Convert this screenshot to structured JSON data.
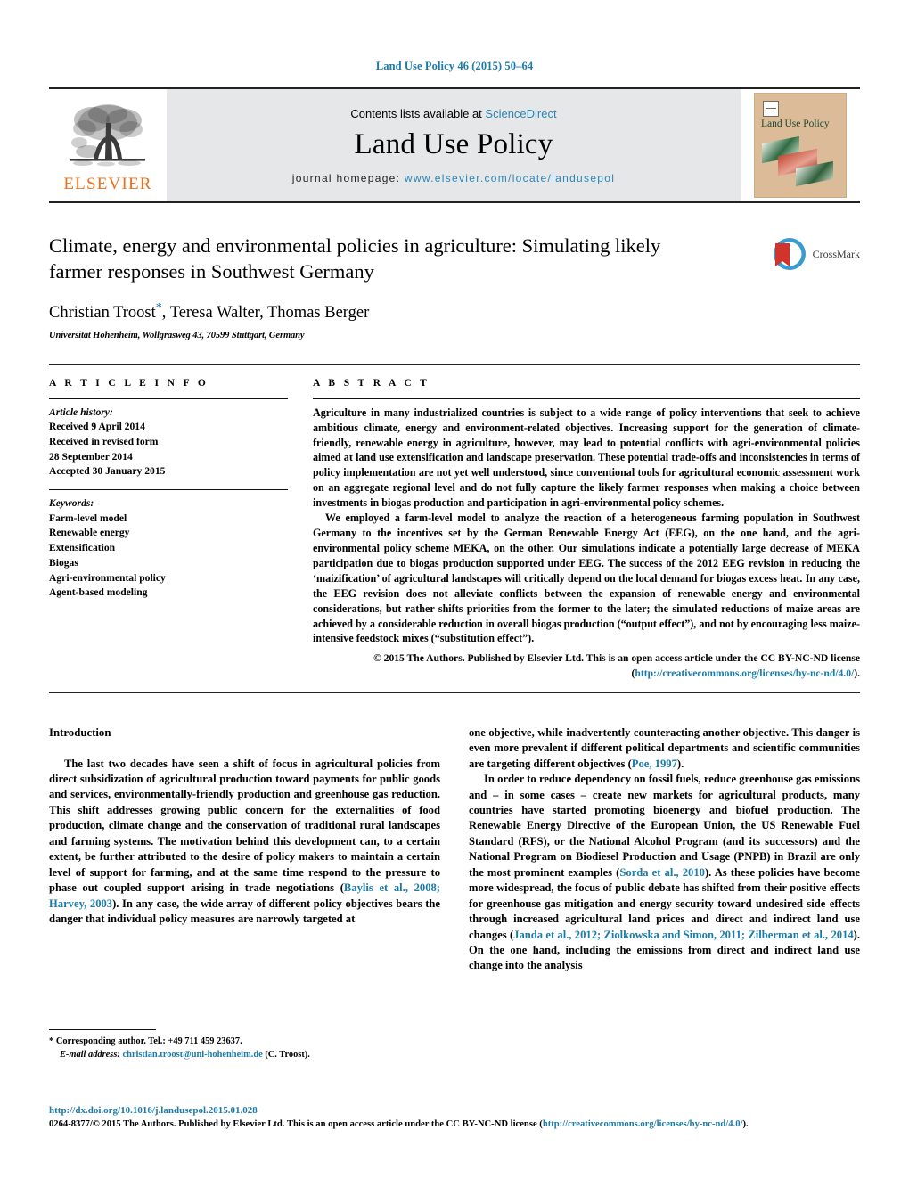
{
  "journal_ref": "Land Use Policy 46 (2015) 50–64",
  "masthead": {
    "publisher_name": "ELSEVIER",
    "contents_prefix": "Contents lists available at ",
    "contents_link": "ScienceDirect",
    "journal_name": "Land Use Policy",
    "homepage_prefix": "journal homepage: ",
    "homepage_url": "www.elsevier.com/locate/landusepol",
    "cover_title": "Land Use Policy"
  },
  "article": {
    "title": "Climate, energy and environmental policies in agriculture: Simulating likely farmer responses in Southwest Germany",
    "authors": "Christian Troost",
    "authors_rest": ", Teresa Walter, Thomas Berger",
    "corresponding_marker": "*",
    "affiliation": "Universität Hohenheim, Wollgrasweg 43, 70599 Stuttgart, Germany",
    "crossmark_label": "CrossMark"
  },
  "article_info": {
    "heading": "A R T I C L E   I N F O",
    "history_label": "Article history:",
    "history": [
      "Received 9 April 2014",
      "Received in revised form",
      "28 September 2014",
      "Accepted 30 January 2015"
    ],
    "keywords_label": "Keywords:",
    "keywords": [
      "Farm-level model",
      "Renewable energy",
      "Extensification",
      "Biogas",
      "Agri-environmental policy",
      "Agent-based modeling"
    ]
  },
  "abstract": {
    "heading": "A B S T R A C T",
    "paragraph1": "Agriculture in many industrialized countries is subject to a wide range of policy interventions that seek to achieve ambitious climate, energy and environment-related objectives. Increasing support for the generation of climate-friendly, renewable energy in agriculture, however, may lead to potential conflicts with agri-environmental policies aimed at land use extensification and landscape preservation. These potential trade-offs and inconsistencies in terms of policy implementation are not yet well understood, since conventional tools for agricultural economic assessment work on an aggregate regional level and do not fully capture the likely farmer responses when making a choice between investments in biogas production and participation in agri-environmental policy schemes.",
    "paragraph2": "We employed a farm-level model to analyze the reaction of a heterogeneous farming population in Southwest Germany to the incentives set by the German Renewable Energy Act (EEG), on the one hand, and the agri-environmental policy scheme MEKA, on the other. Our simulations indicate a potentially large decrease of MEKA participation due to biogas production supported under EEG. The success of the 2012 EEG revision in reducing the ‘maizification’ of agricultural landscapes will critically depend on the local demand for biogas excess heat. In any case, the EEG revision does not alleviate conflicts between the expansion of renewable energy and environmental considerations, but rather shifts priorities from the former to the later; the simulated reductions of maize areas are achieved by a considerable reduction in overall biogas production (“output effect”), and not by encouraging less maize-intensive feedstock mixes (“substitution effect”).",
    "copyright_text_1": "© 2015 The Authors. Published by Elsevier Ltd. This is an open access article under the CC BY-NC-ND license (",
    "copyright_link": "http://creativecommons.org/licenses/by-nc-nd/4.0/",
    "copyright_text_2": ")."
  },
  "introduction": {
    "heading": "Introduction",
    "left_p1_a": "The last two decades have seen a shift of focus in agricultural policies from direct subsidization of agricultural production toward payments for public goods and services, environmentally-friendly production and greenhouse gas reduction. This shift addresses growing public concern for the externalities of food production, climate change and the conservation of traditional rural landscapes and farming systems. The motivation behind this development can, to a certain extent, be further attributed to the desire of policy makers to maintain a certain level of support for farming, and at the same time respond to the pressure to phase out coupled support arising in trade negotiations (",
    "left_cite1": "Baylis et al., 2008; Harvey, 2003",
    "left_p1_b": "). In any case, the wide array of different policy objectives bears the danger that individual policy measures are narrowly targeted at",
    "right_p1_a": "one objective, while inadvertently counteracting another objective. This danger is even more prevalent if different political departments and scientific communities are targeting different objectives (",
    "right_cite1": "Poe, 1997",
    "right_p1_b": ").",
    "right_p2_a": "In order to reduce dependency on fossil fuels, reduce greenhouse gas emissions and – in some cases – create new markets for agricultural products, many countries have started promoting bioenergy and biofuel production. The Renewable Energy Directive of the European Union, the US Renewable Fuel Standard (RFS), or the National Alcohol Program (and its successors) and the National Program on Biodiesel Production and Usage (PNPB) in Brazil are only the most prominent examples (",
    "right_cite2": "Sorda et al., 2010",
    "right_p2_b": "). As these policies have become more widespread, the focus of public debate has shifted from their positive effects for greenhouse gas mitigation and energy security toward undesired side effects through increased agricultural land prices and direct and indirect land use changes (",
    "right_cite3": "Janda et al., 2012; Ziolkowska and Simon, 2011; Zilberman et al., 2014",
    "right_p2_c": "). On the one hand, including the emissions from direct and indirect land use change into the analysis"
  },
  "footnote": {
    "star": "*",
    "corresponding": "Corresponding author. Tel.: +49 711 459 23637.",
    "email_label": "E-mail address:",
    "email": "christian.troost@uni-hohenheim.de",
    "email_suffix": "(C. Troost)."
  },
  "page_footer": {
    "doi": "http://dx.doi.org/10.1016/j.landusepol.2015.01.028",
    "issn_text_1": "0264-8377/© 2015 The Authors. Published by Elsevier Ltd. This is an open access article under the CC BY-NC-ND license (",
    "issn_link": "http://creativecommons.org/licenses/by-nc-nd/4.0/",
    "issn_text_2": ")."
  },
  "colors": {
    "link": "#1a7aa8",
    "elsevier_orange": "#E9711C",
    "masthead_gray": "#e6e7e8",
    "cover_tan": "#dcbb98"
  }
}
